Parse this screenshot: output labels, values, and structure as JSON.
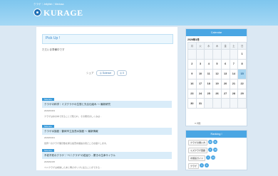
{
  "header": {
    "tagline": "クラゲ｜Jellyfish｜Medusa",
    "logo": "KURAGE"
  },
  "main": {
    "pickup_title": "Pick Up !",
    "pickup_text": "ただいま準備中です",
    "share_label": "シェア",
    "share_button": "◎ Science",
    "share_button2": "◎ 0",
    "articles": [
      {
        "tag": "Science",
        "title": "クラゲの科学｜ミズクラゲの生態と光る仕組み ～ 最新研究",
        "date": "2026/03/03",
        "desc": "クラゲは水の中で光ることで知られ、その発光のしくみは…"
      },
      {
        "tag": "Science",
        "title": "クラゲ水族館｜鶴岡市立加茂水族館 ～ 最新情報",
        "date": "2026/03/01",
        "desc": "世界一のクラゲ展示数を誇る加茂水族館の見どころを紹介します。"
      },
      {
        "tag": "Science",
        "title": "不老不死のクラゲ｜“ベニクラゲ”の若返り…驚きの生命サイクル",
        "date": "2026/02/25",
        "desc": "ベニクラゲは成熟したあと再びポリプに戻ることができる…"
      }
    ]
  },
  "sidebar": {
    "calendar_title": "Calendar",
    "month": "2026年3月",
    "weekdays": [
      "月",
      "火",
      "水",
      "木",
      "金",
      "土",
      "日"
    ],
    "weeks": [
      [
        "",
        "",
        "",
        "",
        "",
        "",
        "1"
      ],
      [
        "2",
        "3",
        "4",
        "5",
        "6",
        "7",
        "8"
      ],
      [
        "9",
        "10",
        "11",
        "12",
        "13",
        "14",
        "15"
      ],
      [
        "16",
        "17",
        "18",
        "19",
        "20",
        "21",
        "22"
      ],
      [
        "23",
        "24",
        "25",
        "26",
        "27",
        "28",
        "29"
      ],
      [
        "30",
        "31",
        "",
        "",
        "",
        "",
        ""
      ]
    ],
    "today": "15",
    "prev_month": "« 2月",
    "ranking_title": "Ranking !",
    "ranking": [
      {
        "label": "クラゲの飼い方",
        "n1": "22",
        "n2": "11"
      },
      {
        "label": "ミズクラゲ図鑑",
        "n1": "9",
        "n2": "18"
      },
      {
        "label": "水族館ガイド",
        "n1": "7",
        "n2": "14"
      },
      {
        "label": "クラゲ",
        "n1": "5",
        "n2": "8"
      }
    ]
  },
  "colors": {
    "accent": "#4aa6e3",
    "header": "#7ec6ee",
    "title_band": "#d9ecf9"
  }
}
